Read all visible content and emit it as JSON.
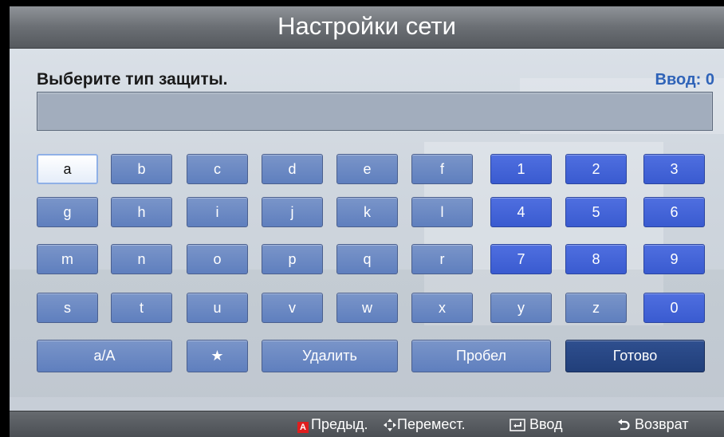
{
  "window": {
    "title": "Настройки сети"
  },
  "form": {
    "prompt": "Выберите тип защиты.",
    "counter": "Ввод: 0",
    "input_value": ""
  },
  "keyboard": {
    "rows": [
      [
        "a",
        "b",
        "c",
        "d",
        "e",
        "f",
        "1",
        "2",
        "3"
      ],
      [
        "g",
        "h",
        "i",
        "j",
        "k",
        "l",
        "4",
        "5",
        "6"
      ],
      [
        "m",
        "n",
        "o",
        "p",
        "q",
        "r",
        "7",
        "8",
        "9"
      ],
      [
        "s",
        "t",
        "u",
        "v",
        "w",
        "x",
        "y",
        "z",
        "0"
      ]
    ],
    "selected_key": "a",
    "bottom": {
      "case_label": "a/A",
      "symbol_label": "★",
      "delete_label": "Удалить",
      "space_label": "Пробел",
      "done_label": "Готово"
    }
  },
  "footer": {
    "prev_badge": "A",
    "prev_label": "Предыд.",
    "move_label": "Перемест.",
    "enter_label": "Ввод",
    "return_label": "Возврат"
  }
}
